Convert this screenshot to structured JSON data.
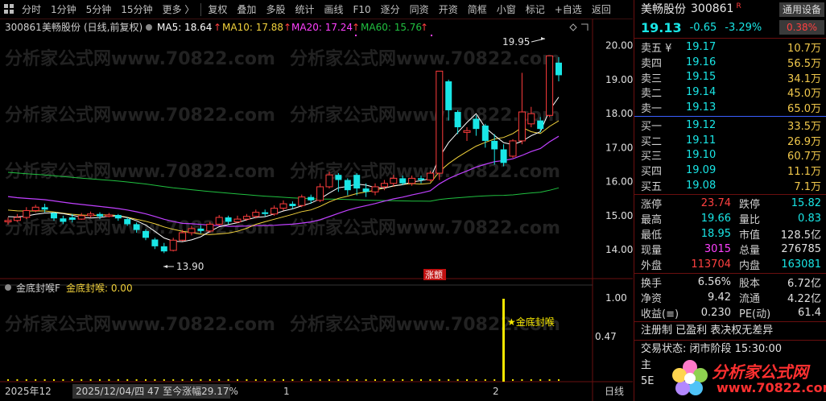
{
  "toolbar": {
    "items": [
      "分时",
      "1分钟",
      "5分钟",
      "15分钟",
      "更多 〉",
      "复权",
      "叠加",
      "多股",
      "统计",
      "画线",
      "F10",
      "逐分",
      "同资",
      "开资",
      "简框",
      "小窗",
      "标记",
      "+自选",
      "返回"
    ]
  },
  "main_chart": {
    "header_code": "300861",
    "header_name": "美畅股份",
    "header_mode": "(日线,前复权)",
    "ma5": "MA5: 18.64",
    "ma10": "MA10: 17.88",
    "ma20": "MA20: 17.24",
    "ma60": "MA60: 15.76",
    "arrow": "↑",
    "high_label": "19.95",
    "low_label": "13.90",
    "event_tag": "涨颤",
    "y_ticks": [
      "20.00",
      "19.00",
      "18.00",
      "17.00",
      "16.00",
      "15.00",
      "14.00"
    ],
    "watermark": "分析家公式网www.70822.com",
    "colors": {
      "up": "#ff3c3c",
      "down": "#19e6e6",
      "ma5": "#ffffff",
      "ma10": "#f2d23c",
      "ma20": "#c040ff",
      "ma60": "#20c040"
    }
  },
  "indicator": {
    "name": "金底封喉F",
    "label": "金底封喉: 0.00",
    "signal_text": "★金底封喉",
    "y_ticks": [
      "1.00",
      "0.47"
    ]
  },
  "bottom_bar": {
    "year": "2025年12",
    "info": "2025/12/04/四  47  至今涨幅29.17%",
    "tick1": "1",
    "tick2": "2",
    "period": "日线"
  },
  "chart_data": {
    "type": "candlestick",
    "ylim": [
      13.6,
      20.3
    ],
    "candles": [
      [
        14.82,
        14.86,
        14.74,
        14.95
      ],
      [
        14.86,
        14.95,
        14.82,
        15.05
      ],
      [
        14.95,
        15.15,
        14.9,
        15.25
      ],
      [
        15.15,
        15.25,
        15.1,
        15.32
      ],
      [
        15.25,
        15.18,
        15.1,
        15.35
      ],
      [
        15.08,
        14.92,
        14.85,
        15.1
      ],
      [
        14.92,
        14.82,
        14.75,
        15.0
      ],
      [
        14.95,
        14.88,
        14.8,
        15.05
      ],
      [
        14.9,
        15.0,
        14.88,
        15.08
      ],
      [
        15.0,
        15.05,
        14.95,
        15.12
      ],
      [
        15.05,
        14.98,
        14.9,
        15.1
      ],
      [
        14.98,
        15.02,
        14.95,
        15.08
      ],
      [
        15.02,
        14.92,
        14.85,
        15.05
      ],
      [
        14.9,
        14.75,
        14.7,
        14.95
      ],
      [
        14.75,
        14.58,
        14.5,
        14.8
      ],
      [
        14.55,
        14.35,
        14.28,
        14.6
      ],
      [
        14.3,
        14.1,
        14.02,
        14.35
      ],
      [
        14.1,
        13.95,
        13.9,
        14.2
      ],
      [
        13.98,
        14.28,
        13.95,
        14.35
      ],
      [
        14.28,
        14.5,
        14.25,
        14.58
      ],
      [
        14.5,
        14.62,
        14.42,
        14.7
      ],
      [
        14.62,
        14.55,
        14.48,
        14.72
      ],
      [
        14.55,
        14.75,
        14.5,
        14.82
      ],
      [
        14.75,
        14.95,
        14.7,
        15.02
      ],
      [
        14.95,
        14.82,
        14.75,
        15.0
      ],
      [
        14.82,
        14.9,
        14.78,
        15.0
      ],
      [
        14.9,
        14.98,
        14.85,
        15.05
      ],
      [
        14.98,
        15.1,
        14.92,
        15.18
      ],
      [
        15.1,
        15.05,
        14.98,
        15.18
      ],
      [
        15.05,
        15.22,
        15.0,
        15.3
      ],
      [
        15.22,
        15.35,
        15.15,
        15.45
      ],
      [
        15.35,
        15.28,
        15.2,
        15.42
      ],
      [
        15.3,
        15.55,
        15.25,
        15.62
      ],
      [
        15.55,
        15.45,
        15.35,
        15.62
      ],
      [
        15.45,
        15.85,
        15.4,
        15.95
      ],
      [
        15.85,
        16.2,
        15.8,
        16.3
      ],
      [
        16.2,
        16.05,
        15.7,
        16.25
      ],
      [
        16.05,
        15.75,
        15.6,
        16.1
      ],
      [
        16.2,
        15.8,
        15.6,
        16.25
      ],
      [
        15.8,
        15.7,
        15.55,
        15.95
      ],
      [
        15.7,
        15.85,
        15.6,
        15.95
      ],
      [
        15.85,
        15.95,
        15.75,
        16.05
      ],
      [
        15.95,
        16.1,
        15.85,
        16.2
      ],
      [
        16.1,
        15.95,
        15.9,
        16.18
      ],
      [
        15.95,
        16.1,
        15.88,
        16.18
      ],
      [
        16.1,
        16.05,
        15.95,
        16.18
      ],
      [
        16.05,
        16.25,
        16.0,
        16.32
      ],
      [
        16.25,
        19.25,
        16.05,
        19.25
      ],
      [
        18.95,
        18.1,
        17.8,
        19.0
      ],
      [
        18.05,
        17.6,
        17.4,
        18.1
      ],
      [
        17.45,
        17.5,
        17.2,
        17.6
      ],
      [
        17.85,
        17.55,
        17.35,
        17.95
      ],
      [
        17.65,
        17.2,
        17.0,
        17.7
      ],
      [
        17.2,
        16.95,
        16.5,
        17.4
      ],
      [
        16.95,
        16.55,
        16.45,
        17.1
      ],
      [
        16.75,
        17.2,
        16.7,
        17.25
      ],
      [
        17.2,
        18.05,
        17.1,
        19.2
      ],
      [
        17.7,
        18.0,
        17.6,
        18.2
      ],
      [
        17.8,
        17.55,
        17.45,
        17.9
      ],
      [
        17.95,
        19.7,
        17.9,
        19.7
      ],
      [
        19.5,
        19.13,
        18.95,
        19.66
      ]
    ]
  },
  "quote": {
    "name": "美畅股份",
    "code": "300861",
    "r_tag": "R",
    "setting_btn": "通用设备",
    "price": "19.13",
    "change": "-0.65",
    "pct": "-3.29%",
    "ratio": "0.38%",
    "sell": [
      {
        "label": "卖五 ¥",
        "price": "19.17",
        "vol": "10.7万"
      },
      {
        "label": "卖四",
        "price": "19.16",
        "vol": "56.5万"
      },
      {
        "label": "卖三",
        "price": "19.15",
        "vol": "34.1万"
      },
      {
        "label": "卖二",
        "price": "19.14",
        "vol": "45.0万"
      },
      {
        "label": "卖一",
        "price": "19.13",
        "vol": "65.0万"
      }
    ],
    "buy": [
      {
        "label": "买一",
        "price": "19.12",
        "vol": "33.5万"
      },
      {
        "label": "买二",
        "price": "19.11",
        "vol": "26.9万"
      },
      {
        "label": "买三",
        "price": "19.10",
        "vol": "60.7万"
      },
      {
        "label": "买四",
        "price": "19.09",
        "vol": "11.1万"
      },
      {
        "label": "买五",
        "price": "19.08",
        "vol": "7.1万"
      }
    ],
    "stats1": [
      {
        "l1": "涨停",
        "v1": "23.74",
        "l2": "跌停",
        "v2": "15.82"
      },
      {
        "l1": "最高",
        "v1": "19.66",
        "l2": "量比",
        "v2": "0.83"
      },
      {
        "l1": "最低",
        "v1": "18.95",
        "l2": "市值",
        "v2": "128.5亿"
      },
      {
        "l1": "现量",
        "v1": "3015",
        "l2": "总量",
        "v2": "276785"
      },
      {
        "l1": "外盘",
        "v1": "113704",
        "l2": "内盘",
        "v2": "163081"
      }
    ],
    "stats2": [
      {
        "l1": "换手",
        "v1": "6.56%",
        "l2": "股本",
        "v2": "6.72亿"
      },
      {
        "l1": "净资",
        "v1": "9.42",
        "l2": "流通",
        "v2": "4.22亿"
      },
      {
        "l1": "收益(≡)",
        "v1": "0.230",
        "l2": "PE(动)",
        "v2": "61.4"
      }
    ],
    "reg": "注册制  已盈利  表决权无差异",
    "status": "交易状态: 闭市阶段  15:30:00",
    "zhu": "主",
    "five": "5E",
    "logo1": "分析家公式网",
    "logo2": "www.70822.com"
  }
}
